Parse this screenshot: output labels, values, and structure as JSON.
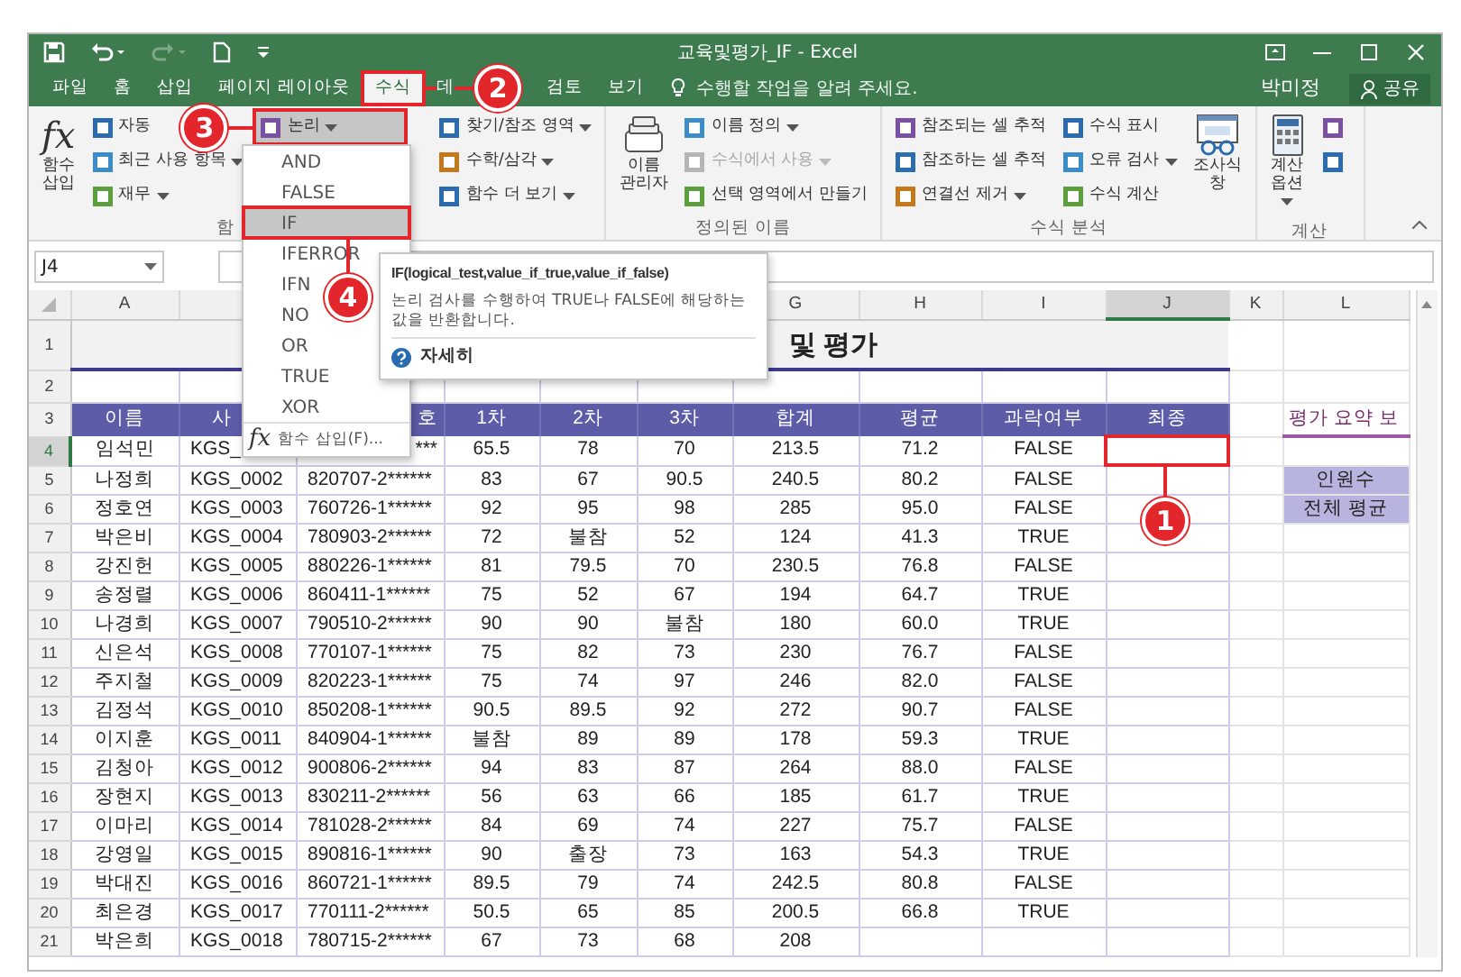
{
  "window": {
    "title": "교육및평가_IF - Excel"
  },
  "tabs": [
    {
      "label": "파일",
      "selected": false
    },
    {
      "label": "홈",
      "selected": false
    },
    {
      "label": "삽입",
      "selected": false
    },
    {
      "label": "페이지 레이아웃",
      "selected": false
    },
    {
      "label": "수식",
      "selected": true
    },
    {
      "label": "데",
      "selected": false
    },
    {
      "label": "검토",
      "selected": false
    },
    {
      "label": "보기",
      "selected": false
    }
  ],
  "tell_me": {
    "placeholder": "수행할 작업을 알려 주세요."
  },
  "user": "박미정",
  "share_button": "공유",
  "ribbon": {
    "groups": [
      {
        "label": "함",
        "columns": [
          [
            {
              "kind": "large",
              "glyph": "fx",
              "label": "함수 삽입",
              "dropdown": false,
              "disabled": false,
              "pressed": false
            }
          ],
          [
            {
              "kind": "small",
              "label": "자동",
              "dropdown": false,
              "disabled": false,
              "pressed": false
            },
            {
              "kind": "small",
              "label": "최근 사용 항목",
              "dropdown": true,
              "disabled": false,
              "pressed": false
            },
            {
              "kind": "small",
              "label": "재무",
              "dropdown": true,
              "disabled": false,
              "pressed": false
            }
          ],
          [
            {
              "kind": "small",
              "label": "논리",
              "dropdown": true,
              "disabled": false,
              "pressed": true
            }
          ],
          [
            {
              "kind": "small",
              "label": "찾기/참조 영역",
              "dropdown": true,
              "disabled": false,
              "pressed": false
            },
            {
              "kind": "small",
              "label": "수학/삼각",
              "dropdown": true,
              "disabled": false,
              "pressed": false
            },
            {
              "kind": "small",
              "label": "함수 더 보기",
              "dropdown": true,
              "disabled": false,
              "pressed": false
            }
          ]
        ]
      },
      {
        "label": "정의된 이름",
        "columns": [
          [
            {
              "kind": "large",
              "label": "이름 관리자",
              "dropdown": false,
              "disabled": false,
              "pressed": false
            }
          ],
          [
            {
              "kind": "small",
              "label": "이름 정의",
              "dropdown": true,
              "disabled": false,
              "pressed": false
            },
            {
              "kind": "small",
              "label": "수식에서 사용",
              "dropdown": true,
              "disabled": true,
              "pressed": false
            },
            {
              "kind": "small",
              "label": "선택 영역에서 만들기",
              "dropdown": false,
              "disabled": false,
              "pressed": false
            }
          ]
        ]
      },
      {
        "label": "수식 분석",
        "columns": [
          [
            {
              "kind": "small",
              "label": "참조되는 셀 추적",
              "dropdown": false,
              "disabled": false,
              "pressed": false
            },
            {
              "kind": "small",
              "label": "참조하는 셀 추적",
              "dropdown": false,
              "disabled": false,
              "pressed": false
            },
            {
              "kind": "small",
              "label": "연결선 제거",
              "dropdown": true,
              "disabled": false,
              "pressed": false
            }
          ],
          [
            {
              "kind": "small",
              "label": "수식 표시",
              "dropdown": false,
              "disabled": false,
              "pressed": false
            },
            {
              "kind": "small",
              "label": "오류 검사",
              "dropdown": true,
              "disabled": false,
              "pressed": false
            },
            {
              "kind": "small",
              "label": "수식 계산",
              "dropdown": false,
              "disabled": false,
              "pressed": false
            }
          ],
          [
            {
              "kind": "large",
              "label": "조사식 창",
              "dropdown": false,
              "disabled": false,
              "pressed": false
            }
          ]
        ]
      },
      {
        "label": "계산",
        "columns": [
          [
            {
              "kind": "large",
              "label": "계산 옵션",
              "dropdown": true,
              "disabled": false,
              "pressed": false
            }
          ],
          [
            {
              "kind": "icon",
              "dropdown": false,
              "disabled": false,
              "pressed": false
            },
            {
              "kind": "icon",
              "dropdown": false,
              "disabled": false,
              "pressed": false
            }
          ]
        ]
      }
    ]
  },
  "menu": {
    "items": [
      {
        "label": "AND",
        "selected": false
      },
      {
        "label": "FALSE",
        "selected": false
      },
      {
        "label": "IF",
        "selected": true
      },
      {
        "label": "IFERROR",
        "selected": false
      },
      {
        "label": "IFN",
        "selected": false
      },
      {
        "label": "NO",
        "selected": false
      },
      {
        "label": "OR",
        "selected": false
      },
      {
        "label": "TRUE",
        "selected": false
      },
      {
        "label": "XOR",
        "selected": false
      }
    ],
    "footer": {
      "glyph": "fx",
      "label": "함수 삽입(F)..."
    }
  },
  "tooltip": {
    "title": "IF(logical_test,value_if_true,value_if_false)",
    "text": "논리 검사를 수행하여 TRUE나 FALSE에 해당하는 값을 반환합니다.",
    "link": "자세히"
  },
  "callouts": [
    {
      "number": "1"
    },
    {
      "number": "2"
    },
    {
      "number": "3"
    },
    {
      "number": "4"
    }
  ],
  "sheet": {
    "name_box": "J4",
    "column_headers": [
      {
        "label": "A",
        "selected": false
      },
      {
        "label": "G",
        "selected": false
      },
      {
        "label": "H",
        "selected": false
      },
      {
        "label": "I",
        "selected": false
      },
      {
        "label": "J",
        "selected": true
      },
      {
        "label": "K",
        "selected": false
      },
      {
        "label": "L",
        "selected": false
      }
    ],
    "row_headers": [
      {
        "label": "1",
        "selected": false
      },
      {
        "label": "2",
        "selected": false
      },
      {
        "label": "3",
        "selected": false
      },
      {
        "label": "4",
        "selected": true
      },
      {
        "label": "5",
        "selected": false
      },
      {
        "label": "6",
        "selected": false
      },
      {
        "label": "7",
        "selected": false
      },
      {
        "label": "8",
        "selected": false
      },
      {
        "label": "9",
        "selected": false
      },
      {
        "label": "10",
        "selected": false
      },
      {
        "label": "11",
        "selected": false
      },
      {
        "label": "12",
        "selected": false
      },
      {
        "label": "13",
        "selected": false
      },
      {
        "label": "14",
        "selected": false
      },
      {
        "label": "15",
        "selected": false
      },
      {
        "label": "16",
        "selected": false
      },
      {
        "label": "17",
        "selected": false
      },
      {
        "label": "18",
        "selected": false
      },
      {
        "label": "19",
        "selected": false
      },
      {
        "label": "20",
        "selected": false
      },
      {
        "label": "21",
        "selected": false
      }
    ],
    "title": "및 평가",
    "header": [
      "이름",
      "사",
      "호",
      "1차",
      "2차",
      "3차",
      "합계",
      "평균",
      "과락여부",
      "최종"
    ],
    "rows": [
      {
        "cells": [
          "임석민",
          "KGS_",
          "***",
          "65.5",
          "78",
          "70",
          "213.5",
          "71.2",
          "FALSE"
        ]
      },
      {
        "cells": [
          "나정희",
          "KGS_0002",
          "820707-2******",
          "83",
          "67",
          "90.5",
          "240.5",
          "80.2",
          "FALSE"
        ]
      },
      {
        "cells": [
          "정호연",
          "KGS_0003",
          "760726-1******",
          "92",
          "95",
          "98",
          "285",
          "95.0",
          "FALSE"
        ]
      },
      {
        "cells": [
          "박은비",
          "KGS_0004",
          "780903-2******",
          "72",
          "불참",
          "52",
          "124",
          "41.3",
          "TRUE"
        ]
      },
      {
        "cells": [
          "강진헌",
          "KGS_0005",
          "880226-1******",
          "81",
          "79.5",
          "70",
          "230.5",
          "76.8",
          "FALSE"
        ]
      },
      {
        "cells": [
          "송정렬",
          "KGS_0006",
          "860411-1******",
          "75",
          "52",
          "67",
          "194",
          "64.7",
          "TRUE"
        ]
      },
      {
        "cells": [
          "나경희",
          "KGS_0007",
          "790510-2******",
          "90",
          "90",
          "불참",
          "180",
          "60.0",
          "TRUE"
        ]
      },
      {
        "cells": [
          "신은석",
          "KGS_0008",
          "770107-1******",
          "75",
          "82",
          "73",
          "230",
          "76.7",
          "FALSE"
        ]
      },
      {
        "cells": [
          "주지철",
          "KGS_0009",
          "820223-1******",
          "75",
          "74",
          "97",
          "246",
          "82.0",
          "FALSE"
        ]
      },
      {
        "cells": [
          "김정석",
          "KGS_0010",
          "850208-1******",
          "90.5",
          "89.5",
          "92",
          "272",
          "90.7",
          "FALSE"
        ]
      },
      {
        "cells": [
          "이지훈",
          "KGS_0011",
          "840904-1******",
          "불참",
          "89",
          "89",
          "178",
          "59.3",
          "TRUE"
        ]
      },
      {
        "cells": [
          "김청아",
          "KGS_0012",
          "900806-2******",
          "94",
          "83",
          "87",
          "264",
          "88.0",
          "FALSE"
        ]
      },
      {
        "cells": [
          "장현지",
          "KGS_0013",
          "830211-2******",
          "56",
          "63",
          "66",
          "185",
          "61.7",
          "TRUE"
        ]
      },
      {
        "cells": [
          "이마리",
          "KGS_0014",
          "781028-2******",
          "84",
          "69",
          "74",
          "227",
          "75.7",
          "FALSE"
        ]
      },
      {
        "cells": [
          "강영일",
          "KGS_0015",
          "890816-1******",
          "90",
          "출장",
          "73",
          "163",
          "54.3",
          "TRUE"
        ]
      },
      {
        "cells": [
          "박대진",
          "KGS_0016",
          "860721-1******",
          "89.5",
          "79",
          "74",
          "242.5",
          "80.8",
          "FALSE"
        ]
      },
      {
        "cells": [
          "최은경",
          "KGS_0017",
          "770111-2******",
          "50.5",
          "65",
          "85",
          "200.5",
          "66.8",
          "TRUE"
        ]
      },
      {
        "cells": [
          "박은희",
          "KGS_0018",
          "780715-2******",
          "67",
          "73",
          "68",
          "208"
        ]
      }
    ],
    "summary": {
      "title": "평가 요약 보",
      "labels": [
        "인원수",
        "전체 평균"
      ]
    }
  }
}
